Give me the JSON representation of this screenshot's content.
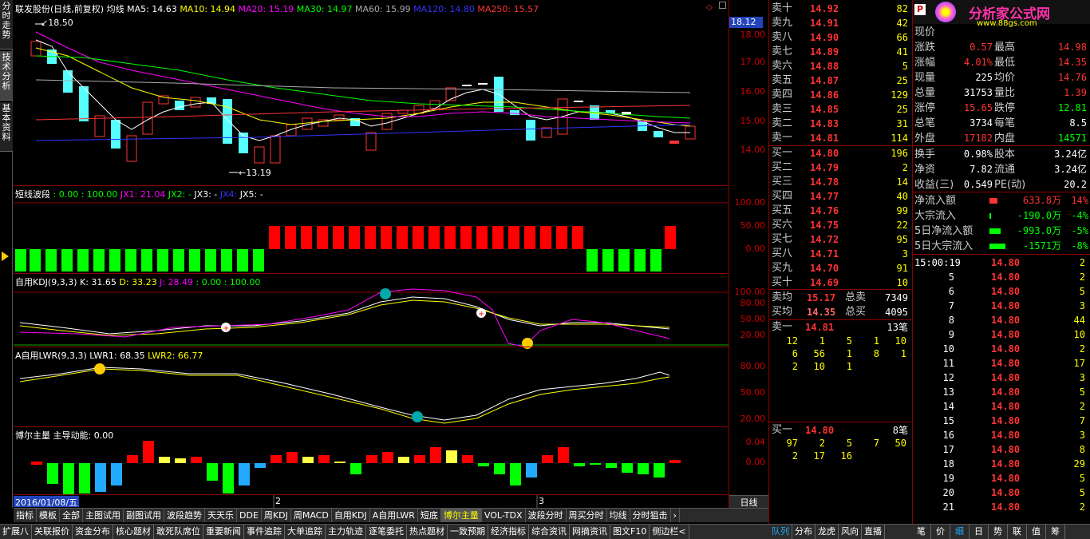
{
  "left_tabs": [
    "分时走势",
    "技术分析",
    "基本资料"
  ],
  "header": {
    "name": "联发股份",
    "period": "(日线,前复权)",
    "type": "均线",
    "ma5": "MA5: 14.63",
    "ma10": "MA10: 14.94",
    "ma20": "MA20: 15.19",
    "ma30": "MA30: 14.97",
    "ma60": "MA60: 15.99",
    "ma120": "MA120: 14.80",
    "ma250": "MA250: 15.57"
  },
  "price_axis": {
    "current": "18.12",
    "ticks": [
      "18.00",
      "17.00",
      "16.00",
      "15.00",
      "14.00"
    ],
    "hi": "18.50",
    "lo": "13.19"
  },
  "wave": {
    "title": "短线波段",
    "values": ": 0.00 : 100.00",
    "jx1": "JX1: 21.04",
    "jx2": "JX2: -",
    "jx3": "JX3: -",
    "jx4": "JX4:",
    "jx5": "JX5: -",
    "ticks": [
      "100.00",
      "50.00",
      "0.00"
    ]
  },
  "kdj": {
    "title": "自用KDJ(9,3,3)",
    "k": "K: 31.65",
    "d": "D: 33.23",
    "j": "J: 28.49",
    "extra": ": 0.00 : 100.00",
    "ticks": [
      "100.00",
      "80.00",
      "50.00",
      "20.00"
    ]
  },
  "lwr": {
    "title": "A自用LWR(9,3,3)",
    "lwr1": "LWR1: 68.35",
    "lwr2": "LWR2: 66.77",
    "ticks": [
      "80.00",
      "50.00",
      "20.00"
    ]
  },
  "boer": {
    "title": "博尔主量 主导动能: 0.00",
    "ticks": [
      "0.04",
      "0.00"
    ]
  },
  "date_label": "2016/01/08/五",
  "month_marks": [
    "2",
    "3"
  ],
  "period_label": "日线",
  "axis_ctrl": [
    "+",
    "-",
    "□"
  ],
  "sell": [
    [
      "卖十",
      "14.92",
      "82"
    ],
    [
      "卖九",
      "14.91",
      "42"
    ],
    [
      "卖八",
      "14.90",
      "66"
    ],
    [
      "卖七",
      "14.89",
      "41"
    ],
    [
      "卖六",
      "14.88",
      "5"
    ],
    [
      "卖五",
      "14.87",
      "25"
    ],
    [
      "卖四",
      "14.86",
      "129"
    ],
    [
      "卖三",
      "14.85",
      "25"
    ],
    [
      "卖二",
      "14.83",
      "31"
    ],
    [
      "卖一",
      "14.81",
      "114"
    ]
  ],
  "buy": [
    [
      "买一",
      "14.80",
      "196"
    ],
    [
      "买二",
      "14.79",
      "2"
    ],
    [
      "买三",
      "14.78",
      "14"
    ],
    [
      "买四",
      "14.77",
      "40"
    ],
    [
      "买五",
      "14.76",
      "99"
    ],
    [
      "买六",
      "14.75",
      "22"
    ],
    [
      "买七",
      "14.72",
      "95"
    ],
    [
      "买八",
      "14.71",
      "3"
    ],
    [
      "买九",
      "14.70",
      "91"
    ],
    [
      "买十",
      "14.69",
      "10"
    ]
  ],
  "avg": {
    "sell_avg_label": "卖均",
    "sell_avg": "15.17",
    "sell_total_label": "总卖",
    "sell_total": "7349",
    "buy_avg_label": "买均",
    "buy_avg": "14.35",
    "buy_total_label": "总买",
    "buy_total": "4095"
  },
  "queue_sell": {
    "label": "卖一",
    "price": "14.81",
    "count": "13笔",
    "rows": [
      [
        "12",
        "1",
        "5",
        "1",
        "10"
      ],
      [
        "6",
        "56",
        "1",
        "8",
        "1"
      ],
      [
        "2",
        "10",
        "1",
        "",
        ""
      ]
    ]
  },
  "queue_buy": {
    "label": "买一",
    "price": "14.80",
    "count": "8笔",
    "rows": [
      [
        "97",
        "2",
        "5",
        "7",
        "50"
      ],
      [
        "2",
        "17",
        "16",
        "",
        ""
      ]
    ]
  },
  "brand": {
    "title": "分析家公式网",
    "url": "www.88gs.com"
  },
  "stats": [
    [
      "现价",
      "",
      ""
    ],
    [
      "涨跌",
      "0.57",
      "最高",
      "14.98"
    ],
    [
      "涨幅",
      "4.01%",
      "最低",
      "14.35"
    ],
    [
      "现量",
      "225",
      "均价",
      "14.76"
    ],
    [
      "总量",
      "31753",
      "量比",
      "1.39"
    ],
    [
      "涨停",
      "15.65",
      "跌停",
      "12.81"
    ],
    [
      "总笔",
      "3734",
      "每笔",
      "8.5"
    ],
    [
      "外盘",
      "17182",
      "内盘",
      "14571"
    ]
  ],
  "stats2": [
    [
      "换手",
      "0.98%",
      "股本",
      "3.24亿"
    ],
    [
      "净资",
      "7.82",
      "流通",
      "3.24亿"
    ],
    [
      "收益(三)",
      "0.549",
      "PE(动)",
      "20.2"
    ]
  ],
  "flow": [
    [
      "净流入额",
      "633.8万",
      "14%"
    ],
    [
      "大宗流入",
      "-190.0万",
      "-4%"
    ],
    [
      "5日净流入额",
      "-993.0万",
      "-5%"
    ],
    [
      "5日大宗流入",
      "-1571万",
      "-8%"
    ]
  ],
  "ticks": {
    "first_time": "15:00:19",
    "rows": [
      [
        "",
        "14.80",
        "2"
      ],
      [
        "5",
        "14.80",
        "2"
      ],
      [
        "6",
        "14.80",
        "5"
      ],
      [
        "7",
        "14.80",
        "3"
      ],
      [
        "8",
        "14.80",
        "44"
      ],
      [
        "9",
        "14.80",
        "10"
      ],
      [
        "10",
        "14.80",
        "2"
      ],
      [
        "11",
        "14.80",
        "17"
      ],
      [
        "12",
        "14.80",
        "3"
      ],
      [
        "13",
        "14.80",
        "5"
      ],
      [
        "14",
        "14.80",
        "2"
      ],
      [
        "15",
        "14.80",
        "7"
      ],
      [
        "16",
        "14.80",
        "3"
      ],
      [
        "17",
        "14.80",
        "8"
      ],
      [
        "18",
        "14.80",
        "29"
      ],
      [
        "19",
        "14.80",
        "5"
      ],
      [
        "20",
        "14.80",
        "5"
      ],
      [
        "21",
        "14.80",
        "2"
      ]
    ]
  },
  "bottom_tabs": [
    "指标",
    "模板",
    "全部",
    "主图试用",
    "副图试用",
    "波段趋势",
    "天天乐",
    "DDE",
    "周KDJ",
    "周MACD",
    "自用KDJ",
    "A自用LWR",
    "短底",
    "博尔主量",
    "VOL-TDX",
    "波段分时",
    "周买分时",
    "均线",
    "分时狙击"
  ],
  "bottom_bar": [
    "扩展八",
    "关联报价",
    "资金分布",
    "核心题材",
    "敢死队席位",
    "重要新闻",
    "事件追踪",
    "大单追踪",
    "主力轨迹",
    "逐笔委托",
    "热点题材",
    "一致预期",
    "经济指标",
    "综合资讯",
    "网摘资讯",
    "图文F10",
    "侧边栏<"
  ],
  "side_tabs": [
    "队列",
    "分布",
    "龙虎",
    "风向",
    "直播"
  ],
  "right_tabs": [
    "笔",
    "价",
    "细",
    "日",
    "势",
    "联",
    "值",
    "筹"
  ]
}
